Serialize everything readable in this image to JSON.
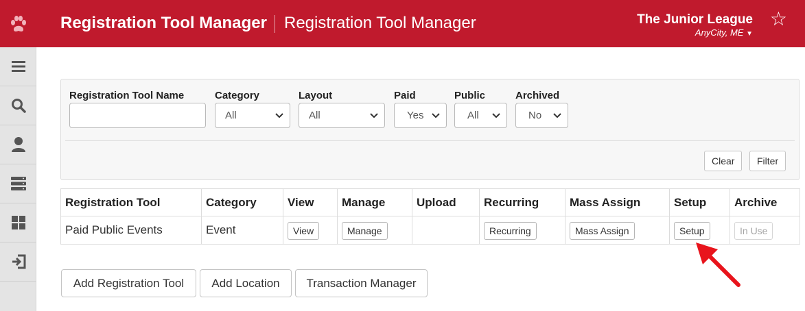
{
  "header": {
    "title": "Registration Tool Manager",
    "subtitle": "Registration Tool Manager",
    "org_name": "The Junior League",
    "org_location": "AnyCity, ME",
    "brand_color": "#c01a2d",
    "logo_icon": "paw-icon",
    "favorite_icon": "star-icon"
  },
  "sidebar": {
    "items": [
      {
        "icon": "menu-icon"
      },
      {
        "icon": "search-icon"
      },
      {
        "icon": "user-icon"
      },
      {
        "icon": "server-icon"
      },
      {
        "icon": "dashboard-icon"
      },
      {
        "icon": "logout-icon"
      }
    ]
  },
  "filters": {
    "name_label": "Registration Tool Name",
    "name_value": "",
    "category_label": "Category",
    "category_value": "All",
    "layout_label": "Layout",
    "layout_value": "All",
    "paid_label": "Paid",
    "paid_value": "Yes",
    "public_label": "Public",
    "public_value": "All",
    "archived_label": "Archived",
    "archived_value": "No",
    "clear_label": "Clear",
    "filter_label": "Filter"
  },
  "table": {
    "headers": [
      "Registration Tool",
      "Category",
      "View",
      "Manage",
      "Upload",
      "Recurring",
      "Mass Assign",
      "Setup",
      "Archive"
    ],
    "rows": [
      {
        "name": "Paid Public Events",
        "category": "Event",
        "view": "View",
        "manage": "Manage",
        "upload": "",
        "recurring": "Recurring",
        "mass_assign": "Mass Assign",
        "setup": "Setup",
        "archive": "In Use"
      }
    ]
  },
  "actions": {
    "add_tool": "Add Registration Tool",
    "add_location": "Add Location",
    "transaction_manager": "Transaction Manager"
  },
  "annotation": {
    "arrow_color": "#e8141c"
  }
}
